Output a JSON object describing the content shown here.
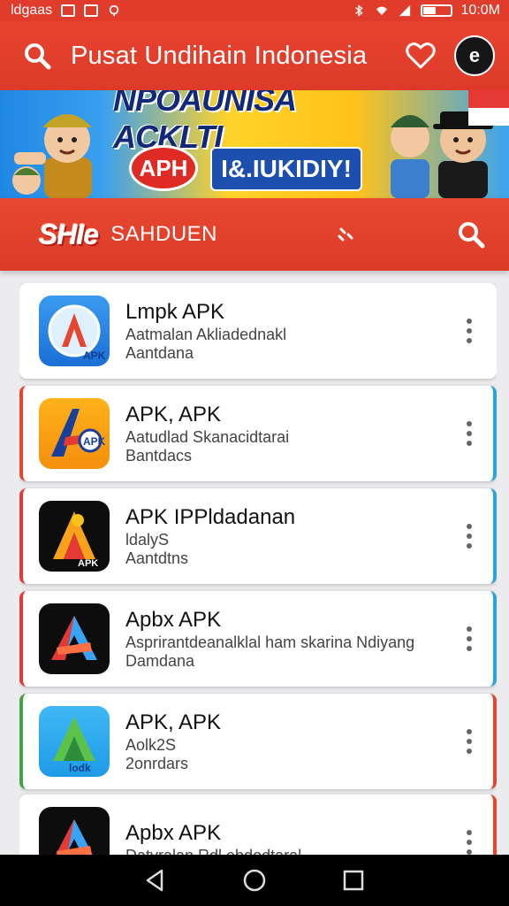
{
  "status_bar": {
    "carrier": "ldgaas",
    "time": "10:0M"
  },
  "header": {
    "title": "Pusat Undihain Indonesia",
    "avatar_text": "e"
  },
  "banner": {
    "headline": "NPOAUNISA ACKLTI",
    "badge": "APH",
    "cta": "I&.IUKIDIY!"
  },
  "section": {
    "brand": "SHIe",
    "label": "SAHDUEN"
  },
  "apps": [
    {
      "name": "Lmpk APK",
      "desc": "Aatmalan Akliadednakl",
      "sub": "Aantdana",
      "icon_style": "blue-circle",
      "accent_left": "",
      "accent_right": ""
    },
    {
      "name": "APK, APK",
      "desc": "Aatudlad Skanacidtarai",
      "sub": "Bantdacs",
      "icon_style": "orange",
      "accent_left": "#e8452f",
      "accent_right": "#29a3dd"
    },
    {
      "name": "APK IPPldadanan",
      "desc": "ldalyS",
      "sub": "Aantdtns",
      "icon_style": "black-orange",
      "accent_left": "#e53935",
      "accent_right": "#29a3dd"
    },
    {
      "name": "Apbx APK",
      "desc": "Asprirantdeanalklal ham skarina Ndiyang",
      "sub": "Damdana",
      "icon_style": "black-multicolor",
      "accent_left": "#e53935",
      "accent_right": "#29a3dd"
    },
    {
      "name": "APK, APK",
      "desc": "Aolk2S",
      "sub": "2onrdars",
      "icon_style": "sky-green",
      "accent_left": "#43a047",
      "accent_right": "#e8452f"
    },
    {
      "name": "Apbx APK",
      "desc": "Datvralan Rdl ebdodtaral",
      "sub": "",
      "icon_style": "black-multicolor",
      "accent_left": "",
      "accent_right": "#e8452f"
    }
  ],
  "colors": {
    "primary": "#e13b2c",
    "banner_yellow": "#ffd32a",
    "banner_blue": "#1e88e5",
    "nav_bar": "#000000"
  },
  "icons": [
    "search-icon",
    "heart-icon",
    "sort-icon",
    "more-vert-icon",
    "back-icon",
    "home-icon",
    "recents-icon",
    "bluetooth-icon",
    "wifi-icon",
    "signal-icon",
    "battery-icon"
  ]
}
